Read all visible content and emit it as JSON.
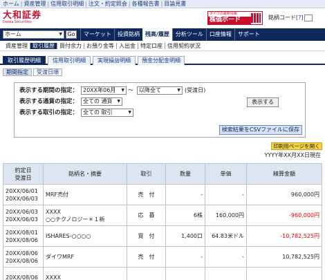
{
  "top_links": [
    "ホーム",
    "資産管理",
    "信用取引明細",
    "注文・約定照会",
    "各種報告書",
    "目論見書"
  ],
  "logo": {
    "main": "大和証券",
    "sub": "Daiwa Securities"
  },
  "banner": {
    "small": "ダイワの最新情報",
    "big": "株価ボード"
  },
  "stock_code": {
    "label": "銘柄コード",
    "help": "[?]"
  },
  "nav": {
    "home_select": "ホーム",
    "go_label": "Go",
    "items": [
      "マーケット",
      "投資銘柄",
      "残高/履歴",
      "分析ツール",
      "口座情報",
      "サポート"
    ]
  },
  "subnav": [
    "資産管理",
    "取引履歴",
    "買付余力",
    "お預り金等",
    "入出金",
    "特定口座",
    "信用契約状況"
  ],
  "tabs": [
    "取引履歴明細",
    "信用取引明細",
    "実現損益明細",
    "預金分配金明細"
  ],
  "subtabs": [
    "期間指定",
    "受渡日順"
  ],
  "filter": {
    "period_label": "表示する期間の指定：",
    "period_from": "20XX年06月",
    "tilde": "～",
    "period_to": "以降全て",
    "period_note": "(受渡日)",
    "currency_label": "表示する通貨の指定：",
    "currency_value": "全ての 通貨",
    "trade_label": "表示する取引の指定：",
    "trade_value": "全ての 取引",
    "display_button": "表示する",
    "csv_button": "検索結果をCSVファイルに保存"
  },
  "print_button": "印刷用ページを開く",
  "as_of": "YYYY年XX月XX日現在",
  "table": {
    "headers": {
      "date1": "約定日",
      "date2": "受渡日",
      "name": "銘柄名・摘要",
      "type": "取引",
      "qty": "数量",
      "price": "単価",
      "amount": "精算金額"
    },
    "rows": [
      {
        "date1": "20XX/06/01",
        "date2": "20XX/06/03",
        "name1": "MRF売付",
        "name2": "",
        "type": "売　付",
        "qty": "-",
        "price": "-",
        "amount": "960,000円",
        "neg": false
      },
      {
        "date1": "20XX/06/03",
        "date2": "20XX/06/03",
        "name1": "XXXX",
        "name2": "○○テクノロジー＊１新",
        "type": "応　募",
        "qty": "6株",
        "price": "160,000円",
        "amount": "-960,000円",
        "neg": true
      },
      {
        "date1": "20XX/08/01",
        "date2": "20XX/08/06",
        "name1": "ISHARES-○○○○",
        "name2": "",
        "type": "買　付",
        "qty": "1,400口",
        "price": "64.83米ドル",
        "amount": "-10,782,525円",
        "neg": true
      },
      {
        "date1": "20XX/08/06",
        "date2": "20XX/08/06",
        "name1": "ダイワMRF",
        "name2": "",
        "type": "売　付",
        "qty": "-",
        "price": "-",
        "amount": "10,782,525円",
        "neg": false
      }
    ],
    "partial_row": {
      "date1": "20XX/08/06",
      "name1": "XXXX"
    }
  }
}
